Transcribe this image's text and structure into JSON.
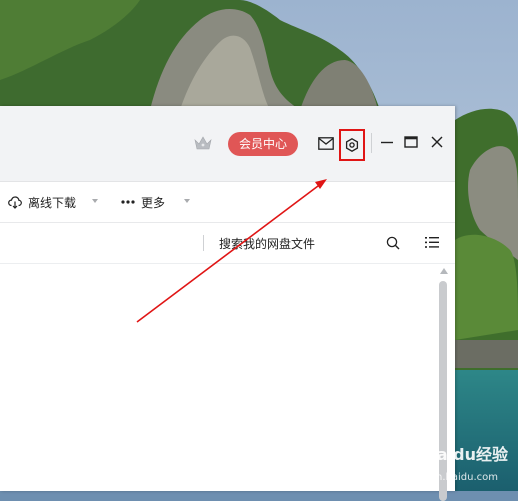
{
  "titlebar": {
    "vip_label": "会员中心"
  },
  "toolbar": {
    "offline_download_label": "离线下载",
    "more_label": "更多"
  },
  "search": {
    "placeholder": "搜索我的网盘文件"
  },
  "watermark": {
    "brand": "Baidu经验",
    "url": "jingyan.baidu.com"
  },
  "colors": {
    "vip_red": "#e05656",
    "highlight_red": "#e01515",
    "titlebar_bg": "#f2f3f5"
  },
  "icons": [
    "crown-icon",
    "mail-icon",
    "gear-icon",
    "minimize-icon",
    "maximize-icon",
    "close-icon",
    "cloud-download-icon",
    "more-dots-icon",
    "search-icon",
    "list-view-icon"
  ]
}
